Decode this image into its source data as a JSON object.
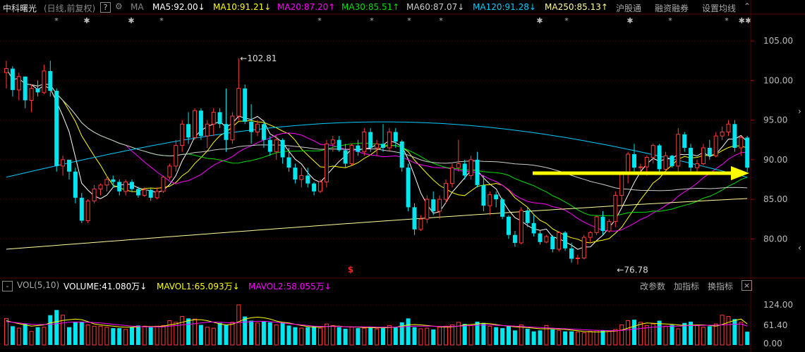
{
  "header": {
    "stock_name": "中科曙光",
    "period": "(日线,前复权)",
    "help": "?",
    "settings_icon": "gear-icon",
    "ma_label": "MA",
    "ma5": {
      "text": "MA5:92.00",
      "arrow": "↓",
      "color": "#ffffff"
    },
    "ma10": {
      "text": "MA10:91.21",
      "arrow": "↓",
      "color": "#ffff00"
    },
    "ma20": {
      "text": "MA20:87.20",
      "arrow": "↑",
      "color": "#ff00ff"
    },
    "ma30": {
      "text": "MA30:85.51",
      "arrow": "↑",
      "color": "#00e000"
    },
    "ma60": {
      "text": "MA60:87.07",
      "arrow": "↓",
      "color": "#cccccc"
    },
    "ma120": {
      "text": "MA120:91.28",
      "arrow": "↓",
      "color": "#00ccff"
    },
    "ma250": {
      "text": "MA250:85.13",
      "arrow": "↑",
      "color": "#ffff99"
    },
    "hgt": "沪股通",
    "margin": "融资融券",
    "setma": "设置均线"
  },
  "markers": [
    "*",
    "✱",
    "✱",
    "*",
    "*",
    "*",
    "*",
    "*",
    "✱",
    "*",
    "✱",
    "*",
    "*",
    "✱✱",
    "*"
  ],
  "price_axis": {
    "ticks": [
      "105.00",
      "100.00",
      "95.00",
      "90.00",
      "85.00",
      "80.00"
    ],
    "min": 75.5,
    "max": 107.5
  },
  "annotations": {
    "high": "102.81",
    "low": "76.78",
    "high_arrow": "←",
    "low_arrow": "←",
    "dividend": "$"
  },
  "volume_bar": {
    "minus": "-",
    "vol": "VOL(5,10)",
    "volume": {
      "text": "VOLUME:41.080万",
      "arrow": "↓",
      "color": "#ffffff"
    },
    "mavol1": {
      "text": "MAVOL1:65.093万",
      "arrow": "↓",
      "color": "#ffff00"
    },
    "mavol2": {
      "text": "MAVOL2:58.055万",
      "arrow": "↓",
      "color": "#ff00ff"
    },
    "edit_params": "改参数",
    "add_indicator": "加指标",
    "switch_indicator": "换指标",
    "close": "×"
  },
  "volume_axis": {
    "ticks": [
      "124.00",
      "61.40",
      "0.00"
    ],
    "max": 124
  },
  "colors": {
    "up": "#ff3b3b",
    "down": "#00e5ee",
    "arrow": "#ffff00",
    "grid": "#5a0000"
  },
  "chart_data": {
    "type": "candlestick",
    "ylim": [
      75.5,
      107.5
    ],
    "candles": [
      [
        101,
        102.5,
        99,
        101.5
      ],
      [
        101.5,
        101.8,
        98,
        98.8
      ],
      [
        98.8,
        101,
        97.5,
        100.5
      ],
      [
        100.5,
        100.5,
        96.5,
        97.5
      ],
      [
        97.5,
        99.5,
        96,
        99
      ],
      [
        99,
        100,
        98,
        98.5
      ],
      [
        98.5,
        102,
        98.3,
        101.2
      ],
      [
        101.2,
        102.5,
        98,
        98.7
      ],
      [
        98.7,
        99,
        88.5,
        89.2
      ],
      [
        89.2,
        90.5,
        88,
        90
      ],
      [
        90,
        90,
        87.5,
        88.5
      ],
      [
        88.5,
        89,
        84.5,
        85.2
      ],
      [
        85.2,
        85.8,
        82,
        82.3
      ],
      [
        82.3,
        85,
        82,
        84.8
      ],
      [
        84.8,
        86.8,
        84.5,
        86.3
      ],
      [
        86.3,
        87,
        85.5,
        86.8
      ],
      [
        86.8,
        88,
        86,
        87.5
      ],
      [
        87.5,
        88,
        86.5,
        87.2
      ],
      [
        87.2,
        87.5,
        85.5,
        86
      ],
      [
        86,
        87.5,
        85.5,
        87.2
      ],
      [
        87.2,
        87.5,
        86,
        86.3
      ],
      [
        86.3,
        86.6,
        85.2,
        85.5
      ],
      [
        85.5,
        86.5,
        85.3,
        86.2
      ],
      [
        86.2,
        86.5,
        84.8,
        85.2
      ],
      [
        85.2,
        86.5,
        85,
        86
      ],
      [
        86,
        88,
        85.8,
        87.8
      ],
      [
        87.8,
        89.5,
        87.5,
        89.2
      ],
      [
        89.2,
        92.5,
        88.5,
        91.8
      ],
      [
        91.8,
        95,
        91,
        94.5
      ],
      [
        94.5,
        96,
        92,
        92.8
      ],
      [
        92.8,
        96.5,
        92.5,
        96.2
      ],
      [
        96.2,
        96.5,
        92.5,
        93
      ],
      [
        93,
        95,
        91.5,
        94.5
      ],
      [
        94.5,
        96.5,
        93,
        96
      ],
      [
        96,
        96.5,
        94,
        94.5
      ],
      [
        94.5,
        99,
        91,
        92.5
      ],
      [
        92.5,
        96,
        92,
        95.5
      ],
      [
        95.5,
        102.8,
        95,
        99
      ],
      [
        99,
        99.5,
        94.5,
        94.8
      ],
      [
        94.8,
        97,
        92,
        93.5
      ],
      [
        93.5,
        95,
        93,
        94.5
      ],
      [
        94.5,
        95,
        91.5,
        92.5
      ],
      [
        92.5,
        93,
        90.5,
        91
      ],
      [
        91,
        93,
        90,
        92.5
      ],
      [
        92.5,
        92.7,
        89.5,
        90.3
      ],
      [
        90.3,
        91.5,
        88.5,
        89
      ],
      [
        89,
        89.5,
        87,
        87.5
      ],
      [
        87.5,
        89,
        86.5,
        88
      ],
      [
        88,
        89,
        86.5,
        87
      ],
      [
        87,
        87.2,
        85.5,
        86
      ],
      [
        86,
        87.5,
        85.8,
        87.2
      ],
      [
        87.2,
        92.5,
        86.5,
        92
      ],
      [
        92,
        93,
        91,
        92.5
      ],
      [
        92.5,
        93,
        91,
        91.2
      ],
      [
        91.2,
        92,
        89,
        89.5
      ],
      [
        89.5,
        92,
        89.3,
        91.8
      ],
      [
        91.8,
        92.5,
        90.5,
        91
      ],
      [
        91,
        94,
        90.5,
        93.5
      ],
      [
        93.5,
        94,
        91,
        91.5
      ],
      [
        91.5,
        92.5,
        90.5,
        92
      ],
      [
        92,
        94.5,
        91,
        91.5
      ],
      [
        91.5,
        94,
        91,
        93.5
      ],
      [
        93.5,
        94,
        91.5,
        92.3
      ],
      [
        92.3,
        92.5,
        88.5,
        89
      ],
      [
        89,
        89.5,
        83.5,
        84
      ],
      [
        84,
        84.5,
        80.5,
        81.2
      ],
      [
        81.2,
        83,
        81,
        82.5
      ],
      [
        82.5,
        85.5,
        82,
        85
      ],
      [
        85,
        86,
        83,
        83.5
      ],
      [
        83.5,
        85.5,
        82.5,
        85
      ],
      [
        85,
        87.5,
        84.5,
        87
      ],
      [
        87,
        89.5,
        86.5,
        89
      ],
      [
        89,
        92.5,
        88.5,
        89.5
      ],
      [
        89.5,
        90,
        87.5,
        88
      ],
      [
        88,
        90.5,
        87.5,
        90
      ],
      [
        90,
        91,
        86.5,
        86.8
      ],
      [
        86.8,
        88,
        83.5,
        84.2
      ],
      [
        84.2,
        86,
        83,
        85.6
      ],
      [
        85.6,
        86,
        84,
        85
      ],
      [
        85,
        85.2,
        82.5,
        82.8
      ],
      [
        82.8,
        83,
        80,
        80.5
      ],
      [
        80.5,
        81,
        79,
        79.5
      ],
      [
        79.5,
        84,
        79.3,
        83.6
      ],
      [
        83.6,
        84,
        81.5,
        82
      ],
      [
        82,
        83,
        80.3,
        80.7
      ],
      [
        80.7,
        81,
        79.3,
        79.6
      ],
      [
        79.6,
        80.5,
        79.5,
        80.3
      ],
      [
        80.3,
        80.5,
        78.3,
        78.7
      ],
      [
        78.7,
        81,
        78.4,
        80.8
      ],
      [
        80.8,
        81,
        78.5,
        78.8
      ],
      [
        78.8,
        79.5,
        77,
        77.5
      ],
      [
        77.5,
        78,
        76.78,
        77.6
      ],
      [
        77.6,
        80.5,
        77.4,
        80.2
      ],
      [
        80.2,
        81,
        79.5,
        80.8
      ],
      [
        80.8,
        83,
        80.5,
        82.8
      ],
      [
        82.8,
        83.5,
        80.5,
        81
      ],
      [
        81,
        82.5,
        80.8,
        82.2
      ],
      [
        82.2,
        86,
        81.5,
        85.5
      ],
      [
        85.5,
        88.5,
        84,
        88.2
      ],
      [
        88.2,
        91,
        87,
        90.7
      ],
      [
        90.7,
        92,
        88.5,
        89
      ],
      [
        89,
        89.5,
        88.5,
        89.1
      ],
      [
        89.1,
        90.5,
        88,
        90.3
      ],
      [
        90.3,
        92,
        89.5,
        91.8
      ],
      [
        91.8,
        92,
        88.5,
        88.8
      ],
      [
        88.8,
        91,
        88.5,
        90.5
      ],
      [
        90.5,
        90.6,
        89,
        89.2
      ],
      [
        89.2,
        94,
        88.5,
        93.2
      ],
      [
        93.2,
        93.5,
        91,
        91.5
      ],
      [
        91.5,
        92,
        88.5,
        89
      ],
      [
        89,
        90,
        88.5,
        89.5
      ],
      [
        89.5,
        92,
        89.3,
        91.5
      ],
      [
        91.5,
        92.5,
        90,
        90.5
      ],
      [
        90.5,
        93.5,
        90.3,
        93
      ],
      [
        93,
        94.2,
        92.5,
        93.5
      ],
      [
        93.5,
        95,
        93,
        94.5
      ],
      [
        94.5,
        95,
        91,
        91.5
      ],
      [
        91.5,
        93,
        90.5,
        92.8
      ],
      [
        92.8,
        93,
        88.5,
        89
      ]
    ],
    "volumes": [
      82,
      58,
      52,
      65,
      42,
      55,
      55,
      92,
      108,
      92,
      55,
      70,
      72,
      62,
      58,
      58,
      55,
      52,
      52,
      48,
      55,
      60,
      58,
      55,
      58,
      60,
      75,
      70,
      88,
      82,
      80,
      62,
      55,
      52,
      68,
      62,
      70,
      124,
      88,
      75,
      68,
      72,
      70,
      62,
      68,
      60,
      55,
      52,
      55,
      58,
      52,
      65,
      60,
      55,
      50,
      55,
      52,
      52,
      55,
      50,
      52,
      60,
      55,
      70,
      82,
      55,
      50,
      52,
      48,
      55,
      58,
      62,
      70,
      65,
      60,
      72,
      68,
      58,
      55,
      52,
      58,
      45,
      62,
      50,
      42,
      45,
      60,
      48,
      45,
      42,
      42,
      40,
      38,
      42,
      45,
      45,
      42,
      48,
      62,
      75,
      78,
      70,
      60,
      65,
      75,
      58,
      62,
      50,
      68,
      72,
      60,
      55,
      58,
      65,
      92,
      88,
      80,
      70,
      41
    ],
    "mavol1": [
      75,
      70,
      66,
      62,
      58,
      60,
      62,
      68,
      72,
      76,
      78,
      80,
      78,
      72,
      65,
      62,
      60,
      58,
      56,
      55,
      55,
      56,
      57,
      57,
      57,
      58,
      62,
      65,
      70,
      75,
      78,
      78,
      75,
      70,
      65,
      62,
      64,
      72,
      80,
      84,
      86,
      84,
      80,
      74,
      70,
      68,
      64,
      60,
      57,
      55,
      55,
      57,
      58,
      58,
      56,
      56,
      55,
      54,
      54,
      53,
      53,
      54,
      55,
      58,
      62,
      63,
      62,
      60,
      58,
      56,
      55,
      56,
      58,
      62,
      63,
      65,
      67,
      66,
      63,
      60,
      58,
      56,
      55,
      54,
      52,
      50,
      50,
      50,
      49,
      48,
      46,
      44,
      42,
      41,
      40,
      41,
      42,
      43,
      46,
      52,
      58,
      64,
      68,
      67,
      66,
      65,
      64,
      62,
      60,
      61,
      62,
      62,
      60,
      58,
      63,
      70,
      76,
      80,
      65
    ],
    "mavol2": [
      72,
      70,
      68,
      66,
      64,
      63,
      63,
      64,
      66,
      68,
      70,
      71,
      71,
      70,
      69,
      68,
      66,
      64,
      62,
      60,
      58,
      57,
      56,
      56,
      56,
      56,
      58,
      60,
      62,
      64,
      66,
      68,
      70,
      71,
      70,
      69,
      68,
      69,
      71,
      72,
      73,
      73,
      72,
      70,
      68,
      66,
      64,
      62,
      60,
      58,
      57,
      57,
      57,
      57,
      56,
      56,
      56,
      56,
      56,
      55,
      55,
      55,
      55,
      56,
      57,
      58,
      58,
      58,
      58,
      57,
      57,
      57,
      58,
      59,
      60,
      61,
      62,
      62,
      61,
      60,
      59,
      58,
      57,
      56,
      55,
      54,
      53,
      52,
      51,
      50,
      49,
      48,
      47,
      46,
      45,
      45,
      44,
      44,
      45,
      47,
      49,
      51,
      53,
      55,
      56,
      57,
      58,
      58,
      59,
      60,
      60,
      61,
      61,
      61,
      62,
      63,
      64,
      65,
      58
    ]
  }
}
